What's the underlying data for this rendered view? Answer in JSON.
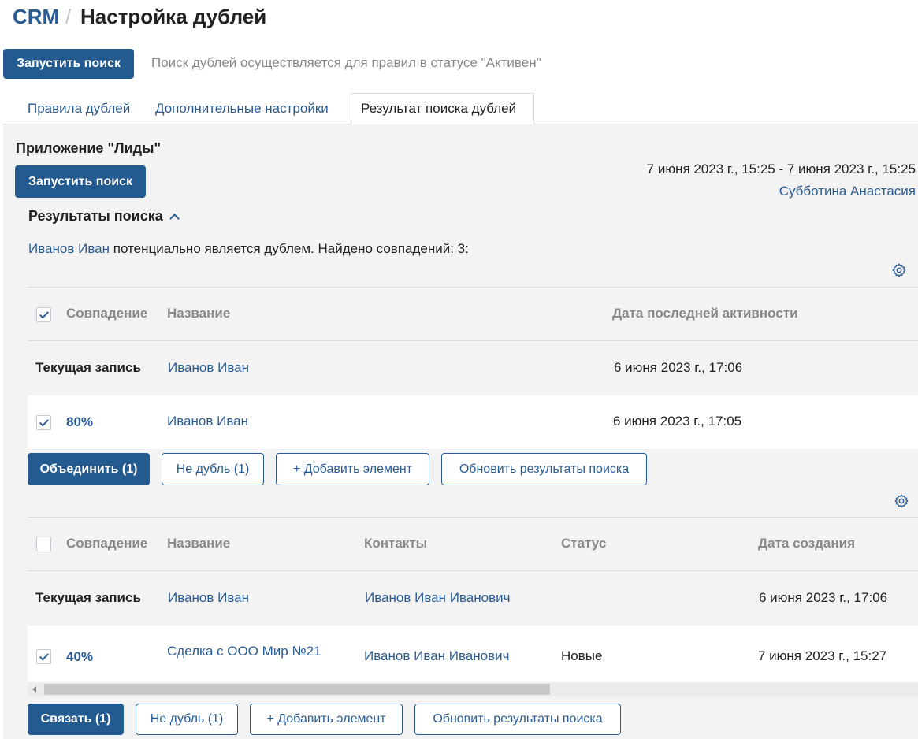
{
  "breadcrumb": {
    "root": "CRM",
    "separator": "/",
    "title": "Настройка дублей"
  },
  "top": {
    "run_search_label": "Запустить поиск",
    "hint": "Поиск дублей осуществляется для правил в статусе \"Активен\""
  },
  "tabs": [
    {
      "label": "Правила дублей",
      "active": false
    },
    {
      "label": "Дополнительные настройки",
      "active": false
    },
    {
      "label": "Результат поиска дублей",
      "active": true
    }
  ],
  "app_section": {
    "title": "Приложение \"Лиды\"",
    "run_search_label": "Запустить поиск",
    "period": "7 июня 2023 г., 15:25 - 7 июня 2023 г., 15:25",
    "author": "Субботина Анастасия",
    "results_title": "Результаты поиска",
    "summary_name": "Иванов Иван",
    "summary_text": " потенциально является дублем. Найдено совпадений: 3:"
  },
  "table1": {
    "header": {
      "match": "Совпадение",
      "name": "Название",
      "last_activity": "Дата последней активности"
    },
    "current": {
      "label": "Текущая запись",
      "name": "Иванов Иван",
      "date": "6 июня 2023 г., 17:06"
    },
    "rows": [
      {
        "checked": true,
        "match": "80%",
        "name": "Иванов Иван",
        "date": "6 июня 2023 г., 17:05"
      }
    ],
    "buttons": {
      "merge": "Объединить (1)",
      "not_duplicate": "Не дубль (1)",
      "add_element": "+ Добавить элемент",
      "refresh": "Обновить результаты поиска"
    }
  },
  "table2": {
    "header": {
      "match": "Совпадение",
      "name": "Название",
      "contacts": "Контакты",
      "status": "Статус",
      "created": "Дата создания"
    },
    "current": {
      "label": "Текущая запись",
      "name": "Иванов Иван",
      "contacts": "Иванов Иван Иванович",
      "status": "",
      "created": "6 июня 2023 г., 17:06"
    },
    "rows": [
      {
        "checked": true,
        "match": "40%",
        "name": "Сделка с ООО Мир №21",
        "contacts": "Иванов Иван Иванович",
        "status": "Новые",
        "created": "7 июня 2023 г., 15:27"
      }
    ],
    "buttons": {
      "link": "Связать (1)",
      "not_duplicate": "Не дубль (1)",
      "add_element": "+ Добавить элемент",
      "refresh": "Обновить результаты поиска"
    }
  },
  "icons": {
    "gear": "settings-gear-icon",
    "chevron": "chevron-up-icon",
    "check": "check-icon"
  },
  "colors": {
    "link": "#2a5c93",
    "primary": "#235a8f",
    "panel_bg": "#f3f3f3",
    "border": "#d8dde2"
  }
}
